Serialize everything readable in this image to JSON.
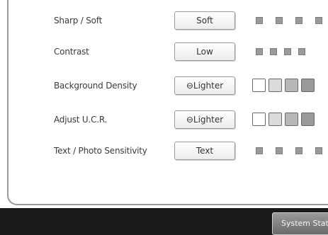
{
  "settings": [
    {
      "label": "Sharp / Soft",
      "value": "Soft",
      "indicator_style": "small",
      "indicator_colors": [
        "#999999",
        "#999999",
        "#999999",
        "#999999"
      ]
    },
    {
      "label": "Contrast",
      "value": "Low",
      "indicator_style": "small",
      "indicator_colors": [
        "#999999",
        "#999999",
        "#999999",
        "#999999"
      ]
    },
    {
      "label": "Background Density",
      "value": "⊖Lighter",
      "indicator_style": "large",
      "indicator_colors": [
        "#ffffff",
        "#dcdcdc",
        "#b8b8b8",
        "#999999"
      ]
    },
    {
      "label": "Adjust U.C.R.",
      "value": "⊖Lighter",
      "indicator_style": "large",
      "indicator_colors": [
        "#ffffff",
        "#dcdcdc",
        "#b8b8b8",
        "#999999"
      ]
    },
    {
      "label": "Text / Photo Sensitivity",
      "value": "Text",
      "indicator_style": "small",
      "indicator_colors": [
        "#999999",
        "#999999",
        "#999999",
        "#999999"
      ]
    }
  ],
  "footer": {
    "status_button_label": "System Status"
  }
}
